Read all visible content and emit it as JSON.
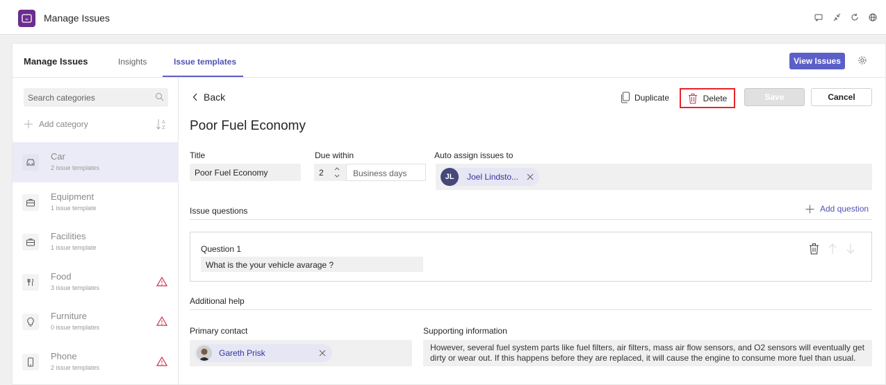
{
  "app": {
    "title": "Manage Issues"
  },
  "titlebar_icons": [
    "chat-icon",
    "collapse-icon",
    "refresh-icon",
    "globe-icon"
  ],
  "tabs": {
    "home": "Manage Issues",
    "insights": "Insights",
    "templates": "Issue templates"
  },
  "header": {
    "view_issues": "View Issues"
  },
  "sidebar": {
    "search_placeholder": "Search categories",
    "add_category": "Add category",
    "categories": [
      {
        "name": "Car",
        "count": "2 issue templates",
        "icon": "car-icon",
        "warning": false
      },
      {
        "name": "Equipment",
        "count": "1 issue template",
        "icon": "briefcase-icon",
        "warning": false
      },
      {
        "name": "Facilities",
        "count": "1 issue template",
        "icon": "briefcase-icon",
        "warning": false
      },
      {
        "name": "Food",
        "count": "3 issue templates",
        "icon": "food-icon",
        "warning": true
      },
      {
        "name": "Furniture",
        "count": "0 issue templates",
        "icon": "lightbulb-icon",
        "warning": true
      },
      {
        "name": "Phone",
        "count": "2 issue templates",
        "icon": "phone-icon",
        "warning": true
      }
    ]
  },
  "toolbar": {
    "back": "Back",
    "duplicate": "Duplicate",
    "delete": "Delete",
    "save": "Save",
    "cancel": "Cancel"
  },
  "template": {
    "title": "Poor Fuel Economy",
    "labels": {
      "title": "Title",
      "due_within": "Due within",
      "auto_assign": "Auto assign issues to"
    },
    "title_value": "Poor Fuel Economy",
    "due_value": "2",
    "due_unit": "Business days",
    "assignee": {
      "initials": "JL",
      "name": "Joel Lindsto..."
    },
    "issue_questions_label": "Issue questions",
    "add_question": "Add question",
    "questions": [
      {
        "label": "Question 1",
        "value": "What is the your vehicle avarage ?"
      }
    ],
    "additional_help": "Additional help",
    "primary_contact_label": "Primary contact",
    "primary_contact": "Gareth Prisk",
    "supporting_label": "Supporting information",
    "supporting_text": "However, several fuel system parts like fuel filters, air filters, mass air flow sensors, and O2 sensors will eventually get dirty or wear out. If this happens before they are replaced, it will cause the engine to consume more fuel than usual."
  },
  "colors": {
    "brand": "#6b2d8f",
    "accent": "#5b5fc7",
    "warning": "#c4314b",
    "highlight": "#e8232a"
  }
}
